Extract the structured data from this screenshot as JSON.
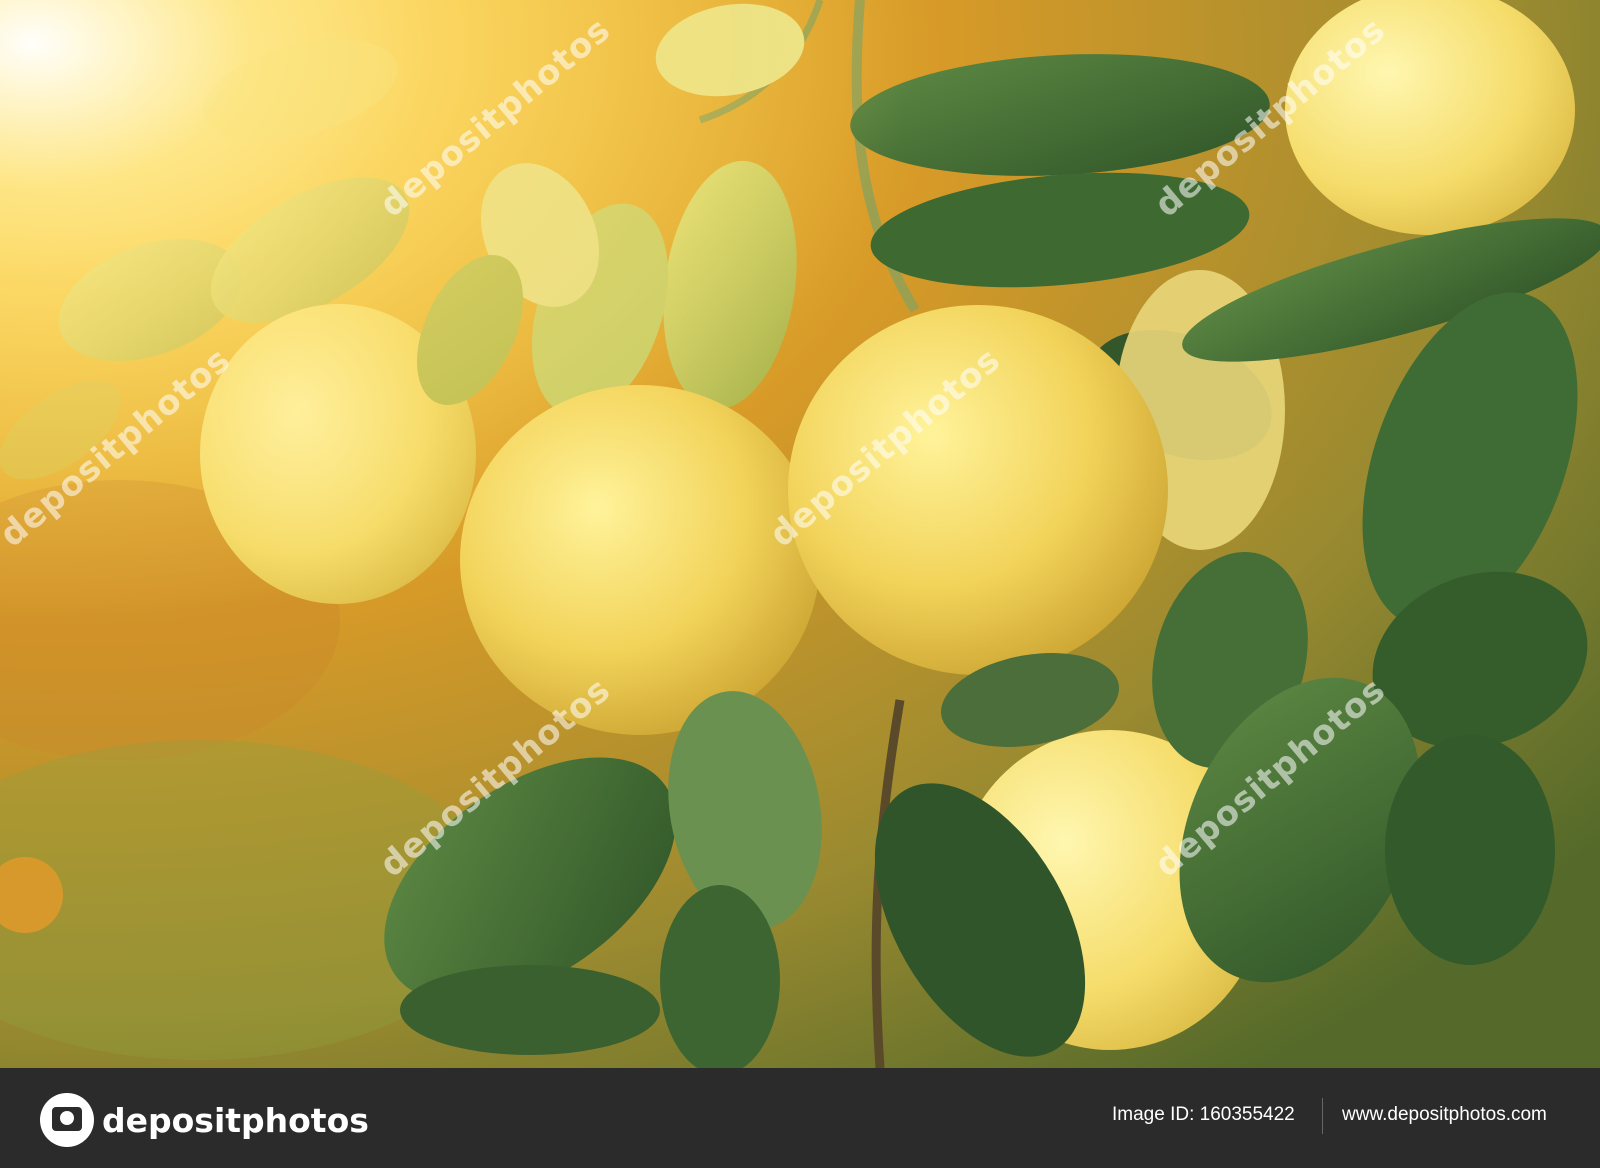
{
  "photo": {
    "subject": "grapefruit",
    "colors": {
      "fruit": "#f2d35a",
      "leaf_dark": "#3f6b34",
      "leaf_light": "#b8c45a",
      "sunlight": "#ffd75a"
    }
  },
  "watermark": {
    "text": "depositphotos"
  },
  "footer": {
    "logo_text": "depositphotos",
    "image_id": "Image ID: 160355422",
    "site_url": "www.depositphotos.com"
  }
}
